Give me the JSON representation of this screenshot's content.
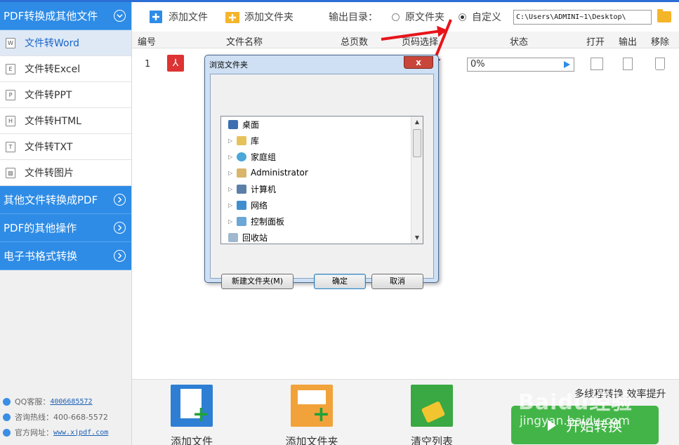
{
  "sidebar": {
    "section1": {
      "title": "PDF转换成其他文件"
    },
    "items": [
      {
        "label": "文件转Word",
        "icon": "W"
      },
      {
        "label": "文件转Excel",
        "icon": "E"
      },
      {
        "label": "文件转PPT",
        "icon": "P"
      },
      {
        "label": "文件转HTML",
        "icon": "H"
      },
      {
        "label": "文件转TXT",
        "icon": "T"
      },
      {
        "label": "文件转图片",
        "icon": "img"
      }
    ],
    "section2": {
      "title": "其他文件转换成PDF"
    },
    "section3": {
      "title": "PDF的其他操作"
    },
    "section4": {
      "title": "电子书格式转换"
    },
    "contact": {
      "qq_label": "QQ客服：",
      "qq_value": "4006685572",
      "hotline": "咨询热线：400-668-5572",
      "site_label": "官方网址：",
      "site_value": "www.xjpdf.com"
    }
  },
  "toolbar": {
    "add_file": "添加文件",
    "add_folder": "添加文件夹",
    "output_label": "输出目录：",
    "option_original": "原文件夹",
    "option_custom": "自定义",
    "output_path": "C:\\Users\\ADMINI~1\\Desktop\\"
  },
  "table": {
    "headers": [
      "编号",
      "文件名称",
      "总页数",
      "页码选择",
      "状态",
      "打开",
      "输出",
      "移除"
    ],
    "rows": [
      {
        "index": "1",
        "progress": "0%"
      }
    ]
  },
  "dialog": {
    "title": "浏览文件夹",
    "close": "x",
    "tree": [
      "桌面",
      "库",
      "家庭组",
      "Administrator",
      "计算机",
      "网络",
      "控制面板",
      "回收站"
    ],
    "new_folder_btn": "新建文件夹(M)",
    "ok_btn": "确定",
    "cancel_btn": "取消"
  },
  "bottom": {
    "add_file": "添加文件",
    "add_folder": "添加文件夹",
    "clear_list": "清空列表",
    "speedup": "多线程转换 效率提升",
    "start": "开始转换"
  },
  "watermark": {
    "line1": "Baidu经验",
    "line2": "jingyan.baidu.com"
  },
  "colors": {
    "accent": "#2e8ce6",
    "start_green": "#43b548",
    "arrow_red": "#e8141b"
  }
}
